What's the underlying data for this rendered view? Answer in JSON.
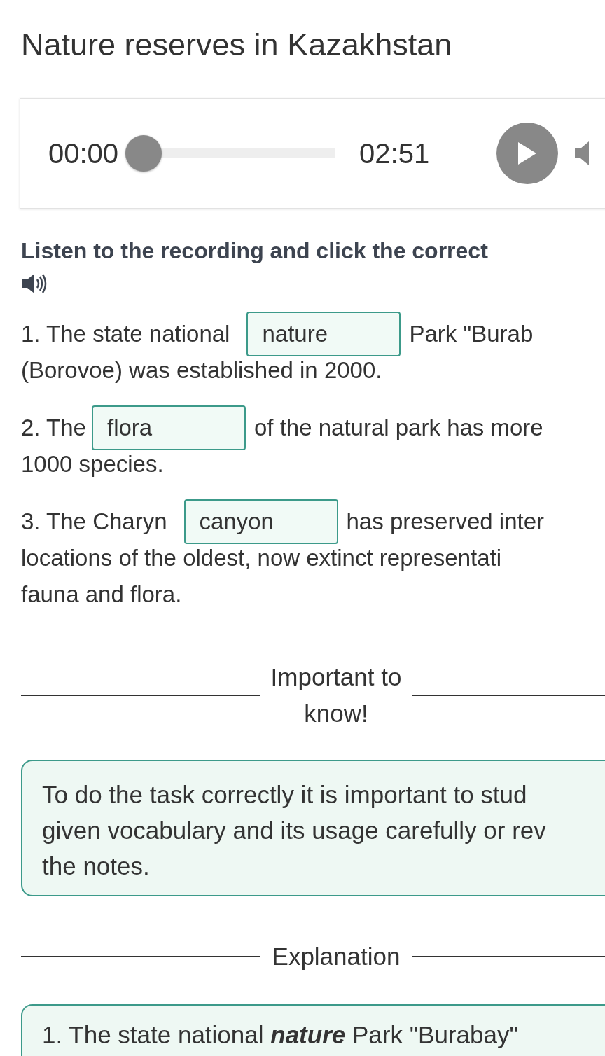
{
  "title": "Nature reserves in Kazakhstan",
  "player": {
    "elapsed": "00:00",
    "level": 0,
    "duration": "02:51"
  },
  "instruction": "Listen to the recording and click the correct",
  "sentences": [
    {
      "lines": [
        [
          {
            "kind": "text",
            "text": "1. The state national"
          },
          {
            "kind": "answer",
            "text": "nature"
          },
          {
            "kind": "text",
            "text": "Park \"Burab"
          }
        ],
        [
          {
            "kind": "text",
            "text": "(Borovoe) was established in 2000."
          }
        ]
      ]
    },
    {
      "lines": [
        [
          {
            "kind": "text",
            "text": "2. The"
          },
          {
            "kind": "answer",
            "text": "flora"
          },
          {
            "kind": "text",
            "text": "of the natural park has more"
          }
        ],
        [
          {
            "kind": "text",
            "text": "1000 species."
          }
        ]
      ]
    },
    {
      "lines": [
        [
          {
            "kind": "text",
            "text": "3. The Charyn"
          },
          {
            "kind": "answer",
            "text": "canyon"
          },
          {
            "kind": "text",
            "text": "has preserved inter"
          }
        ],
        [
          {
            "kind": "text",
            "text": "locations of the oldest, now extinct representati"
          }
        ],
        [
          {
            "kind": "text",
            "text": "fauna and flora."
          }
        ]
      ]
    }
  ],
  "important": {
    "heading": "Important to know!",
    "lines": [
      "To do the task correctly it is important to stud",
      "given vocabulary and its usage carefully or rev",
      "the notes."
    ]
  },
  "explanation": {
    "heading": "Explanation",
    "text": "1. The state national **nature** Park \"Burabay\""
  }
}
